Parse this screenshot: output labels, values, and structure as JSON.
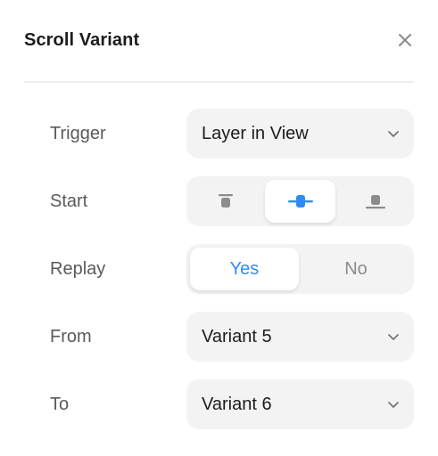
{
  "dialog": {
    "title": "Scroll Variant"
  },
  "rows": {
    "trigger": {
      "label": "Trigger",
      "value": "Layer in View"
    },
    "start": {
      "label": "Start",
      "options": [
        "align-top",
        "align-center",
        "align-bottom"
      ],
      "selected": "align-center"
    },
    "replay": {
      "label": "Replay",
      "yes": "Yes",
      "no": "No",
      "selected": "Yes"
    },
    "from": {
      "label": "From",
      "value": "Variant 5"
    },
    "to": {
      "label": "To",
      "value": "Variant 6"
    }
  },
  "colors": {
    "accent": "#2f8cf0",
    "text": "#1c1c1c",
    "label": "#5a5a5a",
    "muted": "#8c8c8c",
    "control_bg": "#f3f3f3"
  }
}
